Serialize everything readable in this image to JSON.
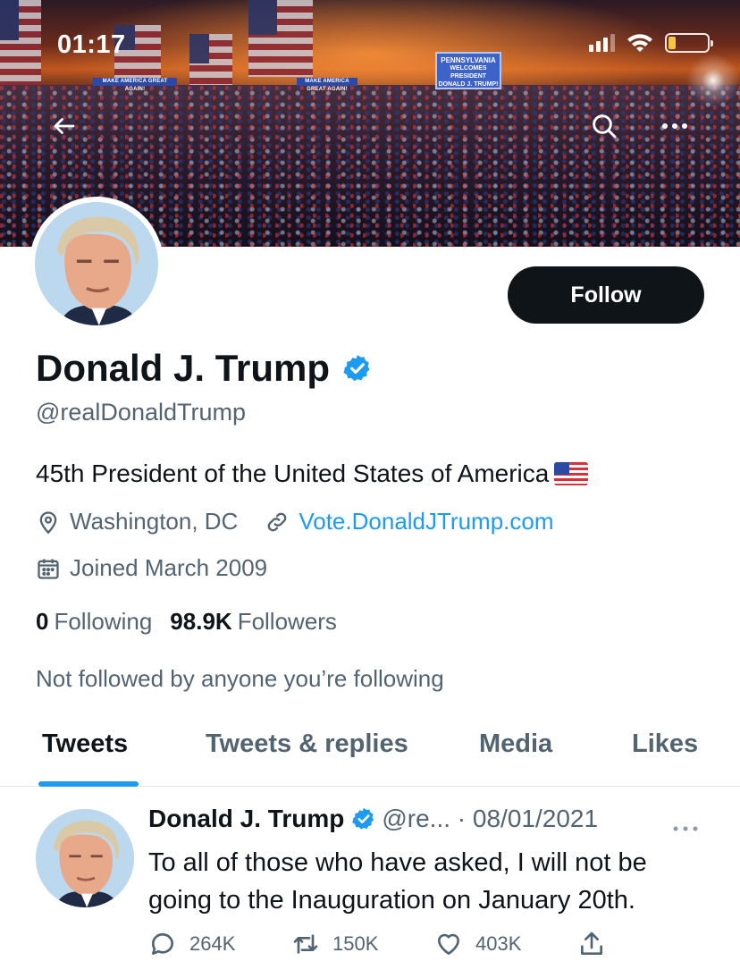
{
  "status_bar": {
    "time": "01:17"
  },
  "banner": {
    "sign_left": "MAKE AMERICA GREAT AGAIN!",
    "sign_mid": "MAKE AMERICA GREAT AGAIN!",
    "sign_main": [
      "PENNSYLVANIA",
      "WELCOMES",
      "PRESIDENT",
      "DONALD J. TRUMP!"
    ]
  },
  "nav": {
    "back_icon": "arrow-left-icon",
    "search_icon": "search-icon",
    "more_icon": "more-horizontal-icon"
  },
  "profile": {
    "follow_label": "Follow",
    "name": "Donald J. Trump",
    "handle": "@realDonaldTrump",
    "bio": "45th President of the United States of America",
    "location": "Washington, DC",
    "website": "Vote.DonaldJTrump.com",
    "joined": "Joined March 2009",
    "following_count": "0",
    "following_label": "Following",
    "followers_count": "98.9K",
    "followers_label": "Followers",
    "not_followed": "Not followed by anyone you’re following"
  },
  "tabs": [
    {
      "label": "Tweets",
      "active": true
    },
    {
      "label": "Tweets & replies",
      "active": false
    },
    {
      "label": "Media",
      "active": false
    },
    {
      "label": "Likes",
      "active": false
    }
  ],
  "tweet": {
    "name": "Donald J. Trump",
    "handle_date": "@re... · 08/01/2021",
    "text": "To all of those who have asked, I will not be going to the Inauguration on January 20th.",
    "replies": "264K",
    "retweets": "150K",
    "likes": "403K"
  },
  "colors": {
    "accent": "#1d9bf0",
    "text": "#0f1419",
    "secondary": "#536471",
    "battery": "#f7c443"
  }
}
